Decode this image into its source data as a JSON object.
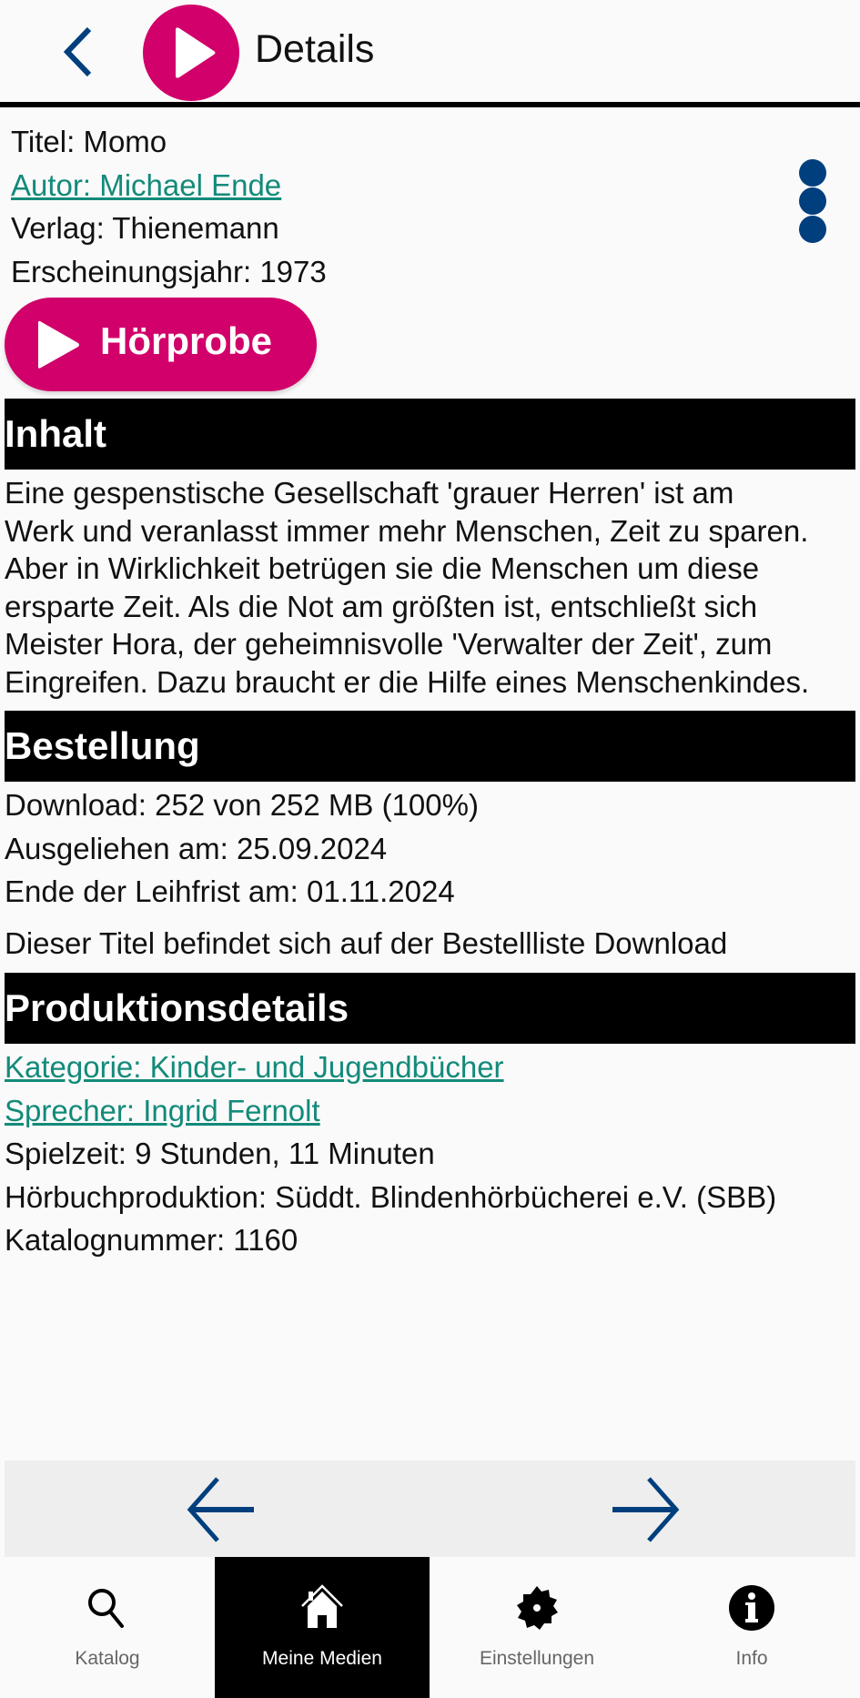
{
  "header": {
    "title": "Details",
    "back_icon": "chevron-left-icon",
    "logo_icon": "play-circle-icon"
  },
  "colors": {
    "accent": "#d1006a",
    "link": "#138a7a",
    "icon_blue": "#003f7e",
    "section_bg": "#000000"
  },
  "book": {
    "title": "Titel: Momo",
    "author": "Autor: Michael Ende",
    "publisher": "Verlag: Thienemann",
    "year": "Erscheinungsjahr: 1973",
    "more_icon": "more-vertical-icon",
    "preview_label": "Hörprobe"
  },
  "sections": {
    "content": {
      "heading": "Inhalt",
      "lines": [
        "Eine gespenstische Gesellschaft 'grauer Herren' ist am",
        "Werk und veranlasst immer mehr Menschen, Zeit zu sparen.",
        "Aber in Wirklichkeit betrügen sie die Menschen um diese",
        "ersparte Zeit. Als die Not am größten ist, entschließt sich",
        "Meister Hora, der geheimnisvolle 'Verwalter der Zeit', zum",
        "Eingreifen. Dazu braucht er die Hilfe eines Menschenkindes."
      ]
    },
    "order": {
      "heading": "Bestellung",
      "download": "Download: 252 von 252 MB (100%)",
      "borrowed": "Ausgeliehen am: 25.09.2024",
      "due": "Ende der Leihfrist am: 01.11.2024",
      "list_note": "Dieser Titel befindet sich auf der Bestellliste Download"
    },
    "production": {
      "heading": "Produktionsdetails",
      "category": "Kategorie: Kinder- und Jugendbücher",
      "narrator": "Sprecher: Ingrid Fernolt",
      "runtime": "Spielzeit: 9 Stunden, 11 Minuten",
      "producer": "Hörbuchproduktion: Süddt. Blindenhörbücherei e.V. (SBB)",
      "catalog_number": "Katalognummer: 1160"
    }
  },
  "pager": {
    "prev_icon": "arrow-left-icon",
    "next_icon": "arrow-right-icon"
  },
  "tabs": [
    {
      "label": "Katalog",
      "icon": "search-icon",
      "active": false
    },
    {
      "label": "Meine Medien",
      "icon": "home-icon",
      "active": true
    },
    {
      "label": "Einstellungen",
      "icon": "gear-icon",
      "active": false
    },
    {
      "label": "Info",
      "icon": "info-icon",
      "active": false
    }
  ]
}
